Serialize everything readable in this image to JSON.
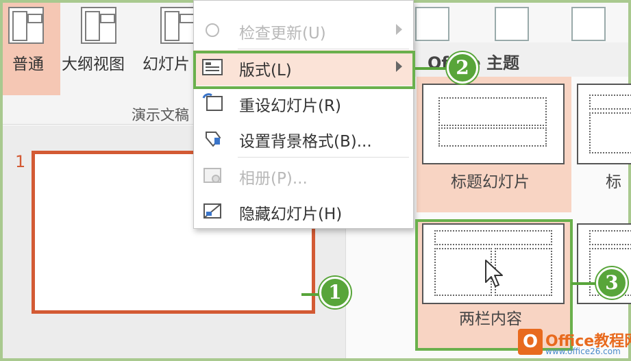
{
  "ribbon": {
    "views": [
      {
        "label": "普通"
      },
      {
        "label": "大纲视图"
      },
      {
        "label": "幻灯片"
      }
    ],
    "group_label": "演示文稿"
  },
  "thumbnail": {
    "number": "1"
  },
  "context_menu": {
    "items": [
      {
        "label": "检查更新(U)",
        "icon": "update-icon",
        "disabled": true,
        "submenu": true
      },
      {
        "label": "版式(L)",
        "icon": "layout-icon",
        "disabled": false,
        "submenu": true
      },
      {
        "label": "重设幻灯片(R)",
        "icon": "reset-slide-icon",
        "disabled": false,
        "submenu": false
      },
      {
        "label": "设置背景格式(B)...",
        "icon": "format-background-icon",
        "disabled": false,
        "submenu": false
      },
      {
        "label": "相册(P)...",
        "icon": "photo-album-icon",
        "disabled": true,
        "submenu": false
      },
      {
        "label": "隐藏幻灯片(H)",
        "icon": "hide-slide-icon",
        "disabled": false,
        "submenu": false
      }
    ]
  },
  "gallery": {
    "header": "Office 主题",
    "layouts": [
      {
        "label": "标题幻灯片"
      },
      {
        "label": "标"
      },
      {
        "label": "两栏内容"
      }
    ]
  },
  "callouts": [
    "1",
    "2",
    "3"
  ],
  "watermark": {
    "title": "Office教程网",
    "logo": "O",
    "url": "www.office26.com"
  },
  "colors": {
    "accent_green": "#58a53a",
    "selection_orange": "#d35a34",
    "highlight": "#f8d4c3"
  }
}
